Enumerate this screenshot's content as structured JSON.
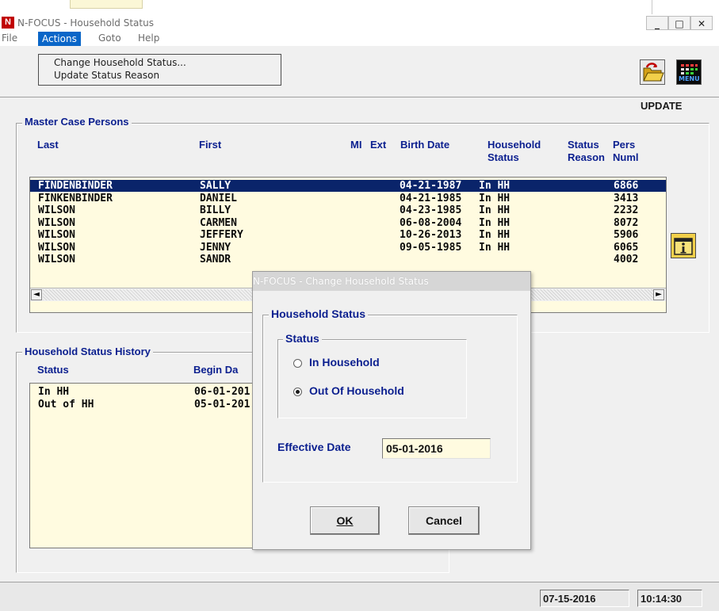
{
  "window": {
    "app_icon": "N",
    "title": "N-FOCUS - Household Status",
    "controls": {
      "minimize": "_",
      "maximize": "□",
      "close": "✕"
    }
  },
  "menu": {
    "items": [
      "File",
      "Actions",
      "Goto",
      "Help"
    ],
    "actions_dropdown": [
      "Change Household Status...",
      "Update Status Reason"
    ]
  },
  "toolbar": {
    "icons": [
      "open-folder-icon",
      "menu-icon"
    ],
    "menu_icon_text": "MENU"
  },
  "mode": "UPDATE",
  "master_case": {
    "title": "Master Case Persons",
    "columns": {
      "last": "Last",
      "first": "First",
      "mi": "MI",
      "ext": "Ext",
      "birth_date": "Birth Date",
      "household_status": [
        "Household",
        "Status"
      ],
      "status_reason": [
        "Status",
        "Reason"
      ],
      "person_number": [
        "Pers",
        "Numl"
      ]
    },
    "rows": [
      {
        "last": "FINDENBINDER",
        "first": "SALLY",
        "birth": "04-21-1987",
        "status": "In HH",
        "number": "6866",
        "selected": true
      },
      {
        "last": "FINKENBINDER",
        "first": "DANIEL",
        "birth": "04-21-1985",
        "status": "In HH",
        "number": "3413"
      },
      {
        "last": "WILSON",
        "first": "BILLY",
        "birth": "04-23-1985",
        "status": "In HH",
        "number": "2232"
      },
      {
        "last": "WILSON",
        "first": "CARMEN",
        "birth": "06-08-2004",
        "status": "In HH",
        "number": "8072"
      },
      {
        "last": "WILSON",
        "first": "JEFFERY",
        "birth": "10-26-2013",
        "status": "In HH",
        "number": "5906"
      },
      {
        "last": "WILSON",
        "first": "JENNY",
        "birth": "09-05-1985",
        "status": "In HH",
        "number": "6065"
      },
      {
        "last": "WILSON",
        "first": "SANDR",
        "birth": "",
        "status": "",
        "number": "4002"
      }
    ],
    "scroll_left": "◄",
    "scroll_right": "►"
  },
  "history": {
    "title": "Household Status History",
    "columns": {
      "status": "Status",
      "begin_date": "Begin Da"
    },
    "rows": [
      {
        "status": "In HH",
        "begin": "06-01-201"
      },
      {
        "status": "Out of HH",
        "begin": "05-01-201"
      }
    ]
  },
  "status_bar": {
    "date": "07-15-2016",
    "time": "10:14:30"
  },
  "dialog": {
    "title": "N-FOCUS - Change Household Status",
    "group_title": "Household Status",
    "status_group_title": "Status",
    "options": [
      {
        "label": "In Household",
        "selected": false
      },
      {
        "label": "Out Of Household",
        "selected": true
      }
    ],
    "effective_date_label": "Effective Date",
    "effective_date_value": "05-01-2016",
    "ok_label": "OK",
    "cancel_label": "Cancel"
  },
  "colors": {
    "accent_menu": "#0a66c8",
    "selection": "#0a246a",
    "label_blue": "#0b1f8f",
    "list_background": "#fffbe0"
  }
}
